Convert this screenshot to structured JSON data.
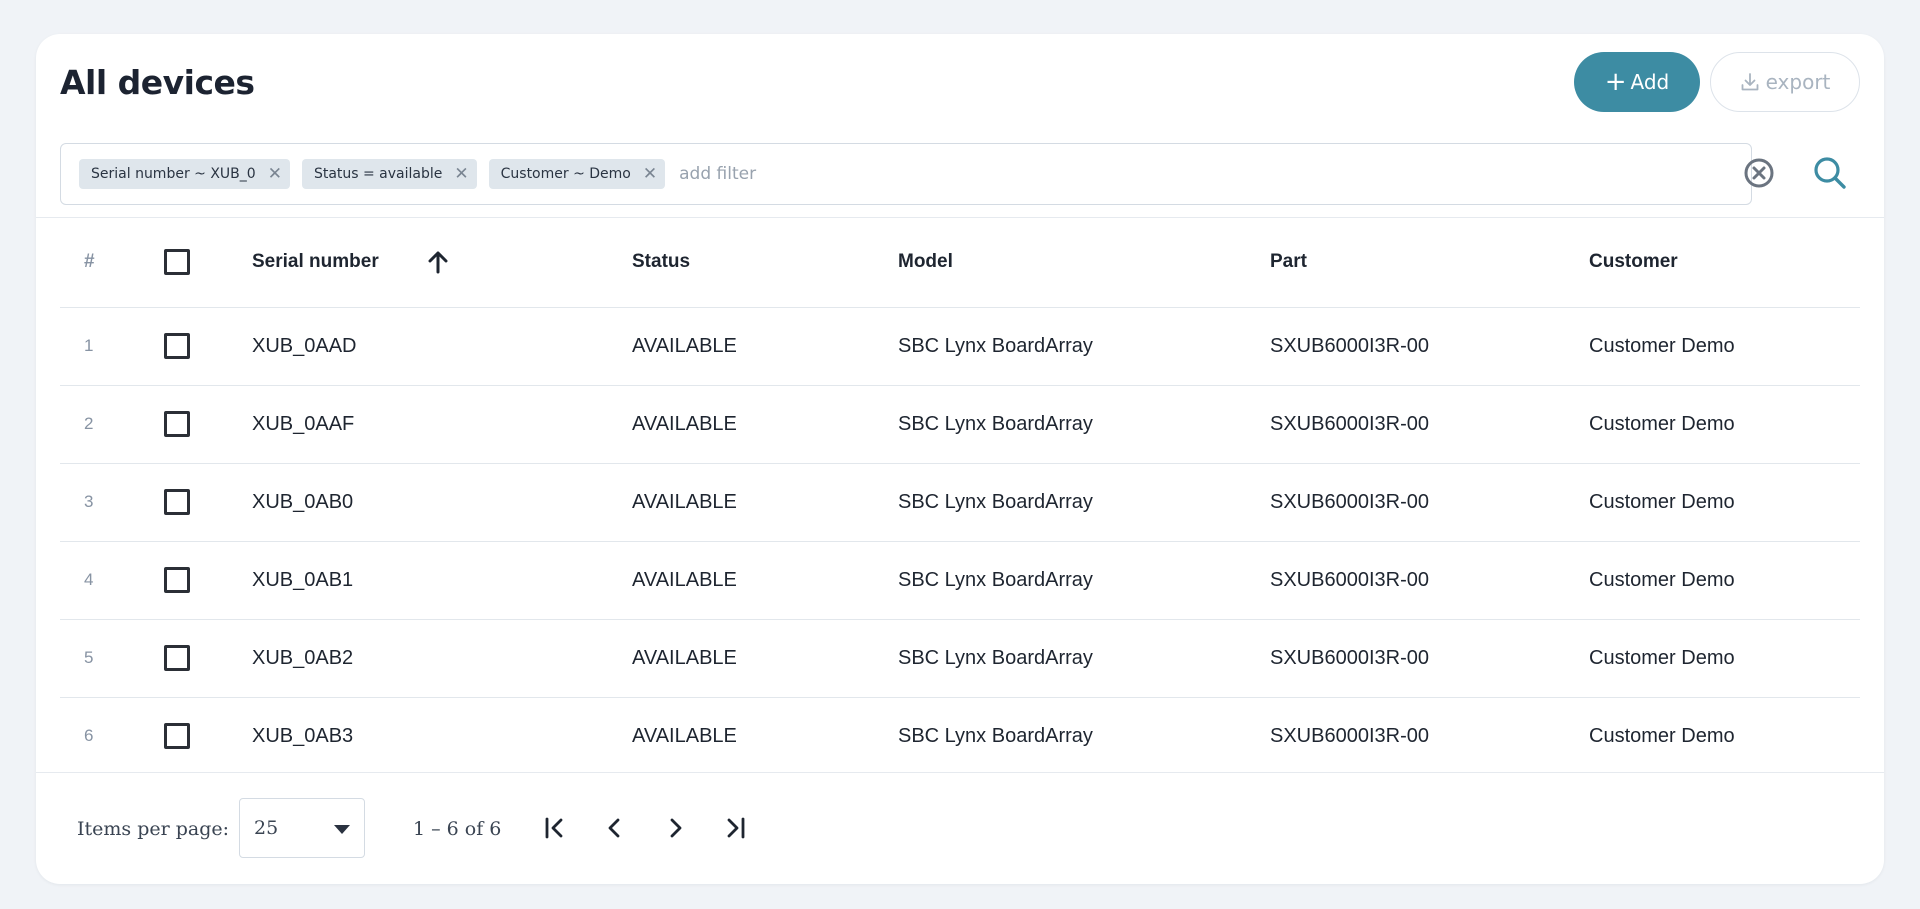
{
  "header": {
    "title": "All devices",
    "add_label": "Add",
    "export_label": "export"
  },
  "filters": {
    "chips": [
      {
        "label": "Serial number ~ XUB_0"
      },
      {
        "label": "Status = available"
      },
      {
        "label": "Customer ~ Demo"
      }
    ],
    "placeholder": "add filter"
  },
  "table": {
    "columns": {
      "num": "#",
      "serial": "Serial number",
      "status": "Status",
      "model": "Model",
      "part": "Part",
      "customer": "Customer"
    },
    "rows": [
      {
        "num": "1",
        "serial": "XUB_0AAD",
        "status": "AVAILABLE",
        "model": "SBC Lynx BoardArray",
        "part": "SXUB6000I3R-00",
        "customer": "Customer Demo"
      },
      {
        "num": "2",
        "serial": "XUB_0AAF",
        "status": "AVAILABLE",
        "model": "SBC Lynx BoardArray",
        "part": "SXUB6000I3R-00",
        "customer": "Customer Demo"
      },
      {
        "num": "3",
        "serial": "XUB_0AB0",
        "status": "AVAILABLE",
        "model": "SBC Lynx BoardArray",
        "part": "SXUB6000I3R-00",
        "customer": "Customer Demo"
      },
      {
        "num": "4",
        "serial": "XUB_0AB1",
        "status": "AVAILABLE",
        "model": "SBC Lynx BoardArray",
        "part": "SXUB6000I3R-00",
        "customer": "Customer Demo"
      },
      {
        "num": "5",
        "serial": "XUB_0AB2",
        "status": "AVAILABLE",
        "model": "SBC Lynx BoardArray",
        "part": "SXUB6000I3R-00",
        "customer": "Customer Demo"
      },
      {
        "num": "6",
        "serial": "XUB_0AB3",
        "status": "AVAILABLE",
        "model": "SBC Lynx BoardArray",
        "part": "SXUB6000I3R-00",
        "customer": "Customer Demo"
      }
    ]
  },
  "pagination": {
    "items_per_page_label": "Items per page:",
    "items_per_page_value": "25",
    "range_label": "1 – 6 of 6"
  },
  "icons": {
    "add": "plus-icon",
    "export": "download-icon",
    "chip_remove": "close-icon",
    "clear": "clear-circle-icon",
    "search": "search-icon",
    "sort": "arrow-up-icon",
    "select_caret": "caret-down-icon",
    "first": "first-page-icon",
    "prev": "chevron-left-icon",
    "next": "chevron-right-icon",
    "last": "last-page-icon"
  },
  "colors": {
    "accent": "#3d8ca3",
    "background": "#f0f3f7",
    "chip": "#dfe6ec"
  }
}
